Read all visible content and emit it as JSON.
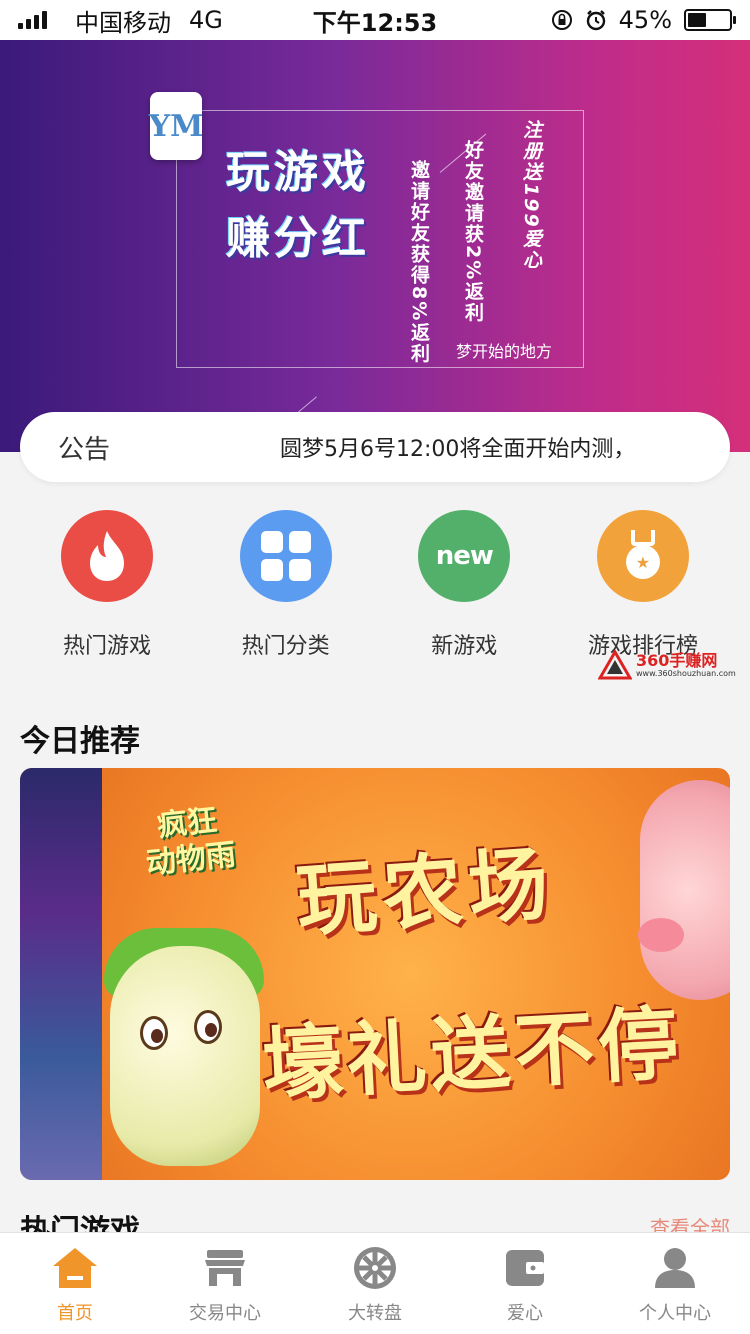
{
  "status_bar": {
    "carrier": "中国移动",
    "network": "4G",
    "time": "下午12:53",
    "battery_percent": "45%",
    "battery_level": 0.45
  },
  "banner": {
    "logo_text": "YM",
    "headline_1": "玩游戏",
    "headline_2": "赚分红",
    "vertical_1": "邀请好友获得8%返利",
    "vertical_2": "好友邀请获2%返利",
    "vertical_3": "注册送199爱心",
    "tagline": "梦开始的地方"
  },
  "notice": {
    "label": "公告",
    "text": "圆梦5月6号12:00将全面开始内测，"
  },
  "categories": [
    {
      "label": "热门游戏",
      "icon": "flame-icon",
      "color": "#e94d45"
    },
    {
      "label": "热门分类",
      "icon": "grid-icon",
      "color": "#5b9cf1"
    },
    {
      "label": "新游戏",
      "icon": "new-icon",
      "color": "#52b06a",
      "icon_text": "new"
    },
    {
      "label": "游戏排行榜",
      "icon": "medal-icon",
      "color": "#f2a23b"
    }
  ],
  "watermark": {
    "text": "360手赚网",
    "url": "www.360shouzhuan.com"
  },
  "today": {
    "title": "今日推荐",
    "promo": {
      "tag_1": "疯狂",
      "tag_2": "动物雨",
      "line_1": "玩农场",
      "line_2": "壕礼送不停"
    }
  },
  "hot_games": {
    "title": "热门游戏",
    "more": "查看全部"
  },
  "tabbar": {
    "items": [
      {
        "label": "首页",
        "icon": "home-icon",
        "active": true
      },
      {
        "label": "交易中心",
        "icon": "store-icon",
        "active": false
      },
      {
        "label": "大转盘",
        "icon": "wheel-icon",
        "active": false
      },
      {
        "label": "爱心",
        "icon": "wallet-icon",
        "active": false
      },
      {
        "label": "个人中心",
        "icon": "person-icon",
        "active": false
      }
    ]
  },
  "colors": {
    "accent": "#f0952a",
    "inactive": "#888888"
  }
}
